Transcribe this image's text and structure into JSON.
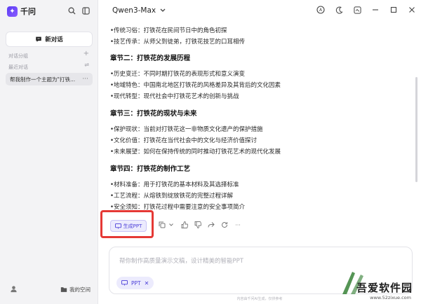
{
  "sidebar": {
    "app_name": "千问",
    "new_chat_label": "新对话",
    "section_groups": "对话分组",
    "section_recent": "最近对话",
    "chat_item": "帮我制作一个主题为\"打铁...",
    "space_label": "我的空间"
  },
  "topbar": {
    "model": "Qwen3-Max"
  },
  "content": {
    "lines_top": [
      "•传统习俗：打铁花在民间节日中的角色初探",
      "•技艺传承：从师父到徒弟，打铁花技艺的口耳相传"
    ],
    "ch2_title": "章节二：打铁花的发展历程",
    "ch2_lines": [
      "•历史变迁：不同时期打铁花的表现形式和意义演变",
      "•地域特色：中国南北地区打铁花的风格差异及其背后的文化因素",
      "•现代转型：现代社会中打铁花艺术的创新与挑战"
    ],
    "ch3_title": "章节三：打铁花的现状与未来",
    "ch3_lines": [
      "•保护现状：当前对打铁花这一非物质文化遗产的保护措施",
      "•文化价值：打铁花在当代社会中的文化与经济价值探讨",
      "•未来展望：如何在保持传统的同时推动打铁花艺术的现代化发展"
    ],
    "ch4_title": "章节四：打铁花的制作工艺",
    "ch4_lines": [
      "•材料准备：用于打铁花的基本材料及其选择标准",
      "•工艺流程：从熔铁到绽放铁花的完整过程详解",
      "•安全须知：打铁花过程中需要注意的安全事项简介"
    ]
  },
  "actions": {
    "generate_ppt": "生成PPT"
  },
  "input": {
    "placeholder": "帮你制作高质量演示文稿，设计精美的智能PPT",
    "tag": "PPT"
  },
  "footer_note": "内容由千问AI生成，仅供参考",
  "watermark": {
    "title": "吾爱软件园",
    "url": "www.52zixue.com"
  },
  "colors": {
    "accent": "#4b3ed8",
    "highlight": "#e53935"
  }
}
